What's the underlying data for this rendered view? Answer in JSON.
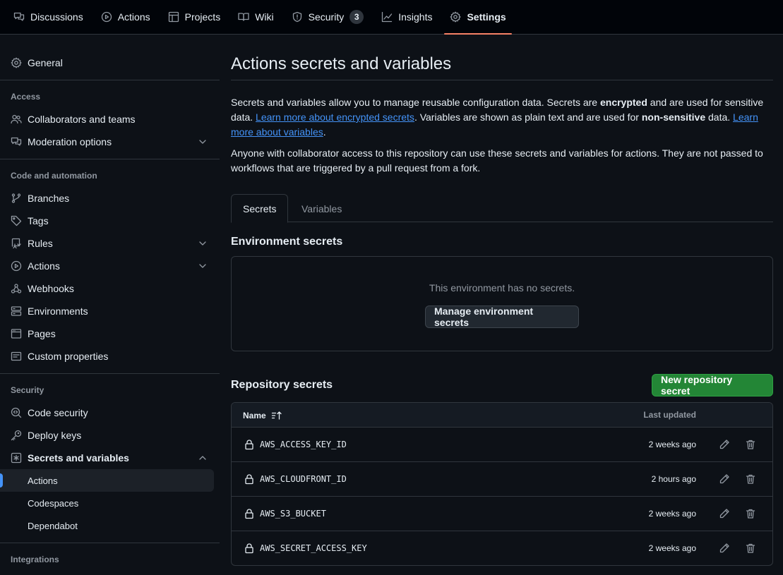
{
  "nav": {
    "tabs": [
      {
        "label": "Discussions",
        "icon": "comment-discussion-icon"
      },
      {
        "label": "Actions",
        "icon": "play-icon"
      },
      {
        "label": "Projects",
        "icon": "table-icon"
      },
      {
        "label": "Wiki",
        "icon": "book-icon"
      },
      {
        "label": "Security",
        "icon": "shield-icon",
        "count": "3"
      },
      {
        "label": "Insights",
        "icon": "graph-icon"
      },
      {
        "label": "Settings",
        "icon": "gear-icon",
        "active": true
      }
    ]
  },
  "sidebar": {
    "general": "General",
    "access_heading": "Access",
    "collaborators": "Collaborators and teams",
    "moderation": "Moderation options",
    "code_heading": "Code and automation",
    "branches": "Branches",
    "tags": "Tags",
    "rules": "Rules",
    "actions": "Actions",
    "webhooks": "Webhooks",
    "environments": "Environments",
    "pages": "Pages",
    "custom_properties": "Custom properties",
    "security_heading": "Security",
    "code_security": "Code security",
    "deploy_keys": "Deploy keys",
    "secrets_and_variables": "Secrets and variables",
    "sub_actions": "Actions",
    "sub_codespaces": "Codespaces",
    "sub_dependabot": "Dependabot",
    "integrations_heading": "Integrations"
  },
  "main": {
    "title": "Actions secrets and variables",
    "intro": {
      "p1_a": "Secrets and variables allow you to manage reusable configuration data. Secrets are ",
      "p1_b": "encrypted",
      "p1_c": " and are used for sensitive data. ",
      "p1_link1": "Learn more about encrypted secrets",
      "p1_d": ". Variables are shown as plain text and are used for ",
      "p1_e": "non-sensitive",
      "p1_f": " data. ",
      "p1_link2": "Learn more about variables",
      "p1_g": ".",
      "p2": "Anyone with collaborator access to this repository can use these secrets and variables for actions. They are not passed to workflows that are triggered by a pull request from a fork."
    },
    "tabs": {
      "secrets": "Secrets",
      "variables": "Variables"
    },
    "env_secrets_title": "Environment secrets",
    "env_empty": "This environment has no secrets.",
    "manage_env_button": "Manage environment secrets",
    "repo_secrets_title": "Repository secrets",
    "new_secret_button": "New repository secret",
    "table": {
      "col_name": "Name",
      "col_updated": "Last updated",
      "rows": [
        {
          "name": "AWS_ACCESS_KEY_ID",
          "updated": "2 weeks ago"
        },
        {
          "name": "AWS_CLOUDFRONT_ID",
          "updated": "2 hours ago"
        },
        {
          "name": "AWS_S3_BUCKET",
          "updated": "2 weeks ago"
        },
        {
          "name": "AWS_SECRET_ACCESS_KEY",
          "updated": "2 weeks ago"
        }
      ]
    }
  },
  "colors": {
    "background": "#0d1117",
    "accent_tab": "#f78166",
    "link": "#4493f8",
    "primary_button": "#238636",
    "border": "#30363d"
  }
}
